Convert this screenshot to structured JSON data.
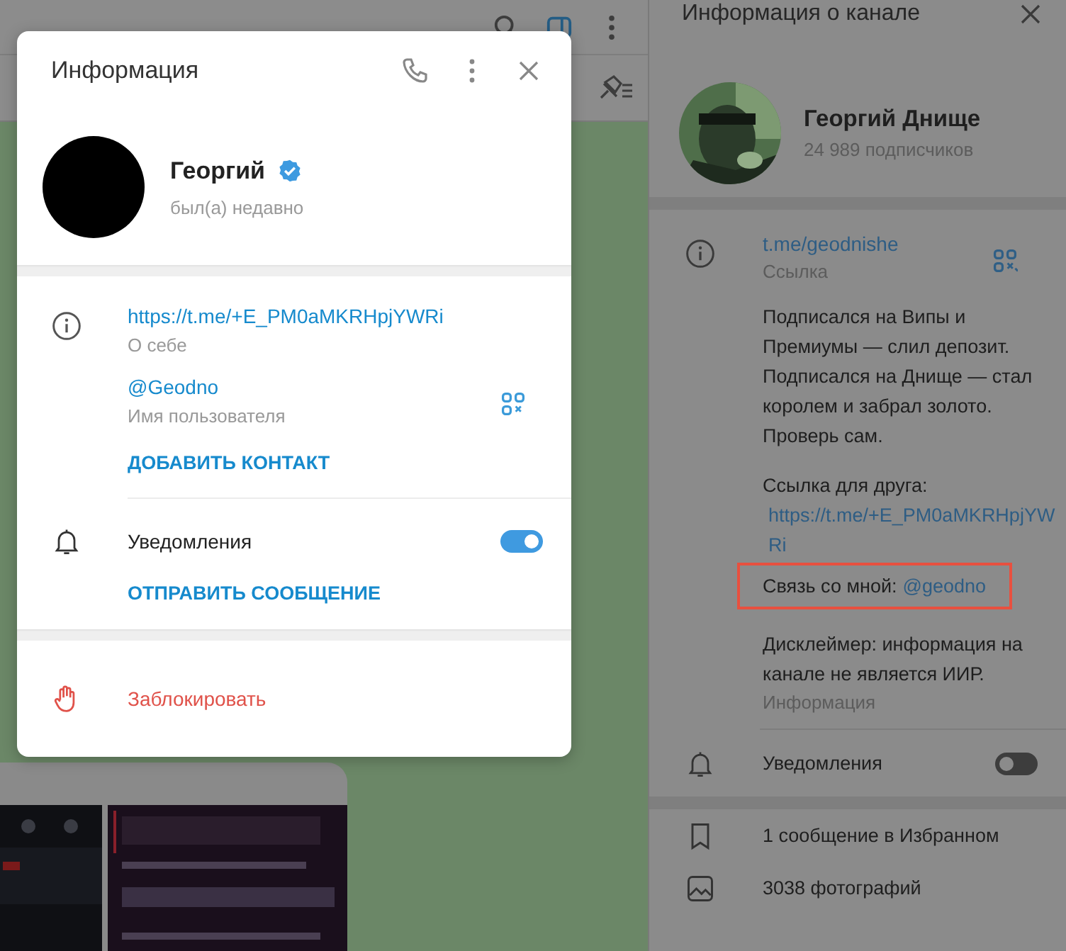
{
  "modal": {
    "title": "Информация",
    "user": {
      "name": "Георгий",
      "verified": true,
      "status": "был(а) недавно"
    },
    "bio": {
      "value": "https://t.me/+E_PM0aMKRHpjYWRi",
      "label": "О себе"
    },
    "username": {
      "value": "@Geodno",
      "label": "Имя пользователя"
    },
    "add_contact": "ДОБАВИТЬ КОНТАКТ",
    "notifications": {
      "label": "Уведомления",
      "on": true
    },
    "send_message": "ОТПРАВИТЬ СООБЩЕНИЕ",
    "block": "Заблокировать"
  },
  "channel_panel": {
    "title": "Информация о канале",
    "channel": {
      "name": "Георгий Днище",
      "subscribers": "24 989 подписчиков"
    },
    "link": {
      "value": "t.me/geodnishe",
      "label": "Ссылка"
    },
    "about": [
      {
        "text": "Подписался на Випы и Премиумы — слил депозит. Подписался на Днище — стал королем и забрал золото. Проверь сам.",
        "highlighted": false
      },
      {
        "text": "Ссылка для друга:",
        "link": "https://t.me/+E_PM0aMKRHpjYWRi",
        "highlighted": false
      },
      {
        "text": "Связь со мной:",
        "link": "@geodno",
        "highlighted": true
      },
      {
        "text": "Дисклеймер: информация на канале не является ИИР.",
        "highlighted": false
      }
    ],
    "about_label": "Информация",
    "notifications": {
      "label": "Уведомления",
      "on": false
    },
    "media": [
      {
        "kind": "saved",
        "label": "1 сообщение в Избранном"
      },
      {
        "kind": "photos",
        "label": "3038 фотографий"
      }
    ]
  }
}
